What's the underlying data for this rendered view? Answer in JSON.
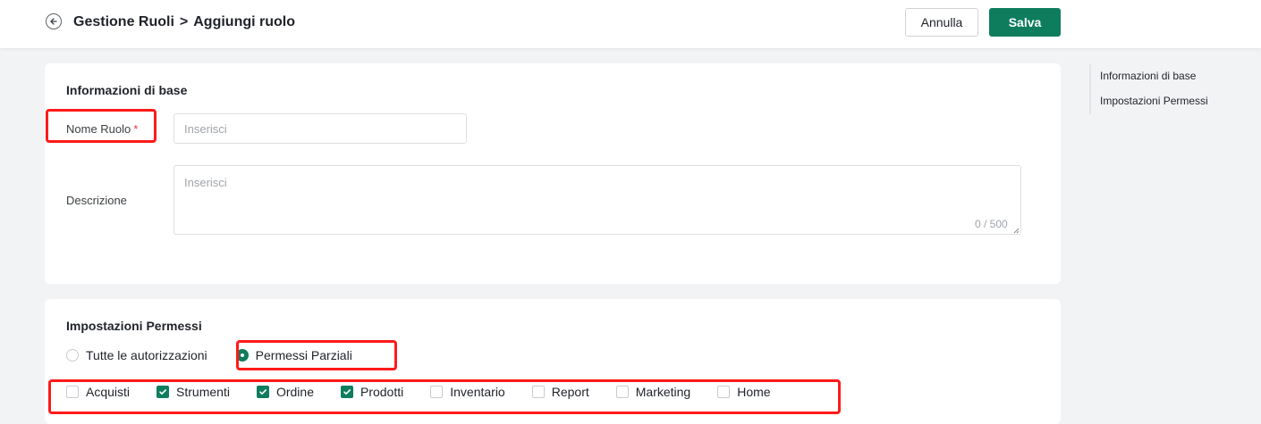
{
  "header": {
    "breadcrumb_parent": "Gestione Ruoli",
    "breadcrumb_separator": ">",
    "breadcrumb_current": "Aggiungi ruolo",
    "cancel_label": "Annulla",
    "save_label": "Salva"
  },
  "basic_info": {
    "title": "Informazioni di base",
    "role_name_label": "Nome Ruolo",
    "required_mark": "*",
    "role_name_value": "",
    "role_name_placeholder": "Inserisci",
    "description_label": "Descrizione",
    "description_value": "",
    "description_placeholder": "Inserisci",
    "description_counter": "0 / 500"
  },
  "permissions": {
    "title": "Impostazioni Permessi",
    "options": [
      {
        "label": "Tutte le autorizzazioni",
        "selected": false
      },
      {
        "label": "Permessi Parziali",
        "selected": true
      }
    ],
    "modules": [
      {
        "label": "Acquisti",
        "checked": false
      },
      {
        "label": "Strumenti",
        "checked": true
      },
      {
        "label": "Ordine",
        "checked": true
      },
      {
        "label": "Prodotti",
        "checked": true
      },
      {
        "label": "Inventario",
        "checked": false
      },
      {
        "label": "Report",
        "checked": false
      },
      {
        "label": "Marketing",
        "checked": false
      },
      {
        "label": "Home",
        "checked": false
      }
    ]
  },
  "toc": {
    "items": [
      "Informazioni di base",
      "Impostazioni Permessi"
    ]
  },
  "colors": {
    "accent": "#0e7d5e",
    "highlight": "#ff1a1a",
    "required": "#e53935"
  },
  "icons": {
    "back": "arrow-left-circle-icon",
    "check": "checkmark-icon",
    "resize": "resize-grip-icon"
  }
}
